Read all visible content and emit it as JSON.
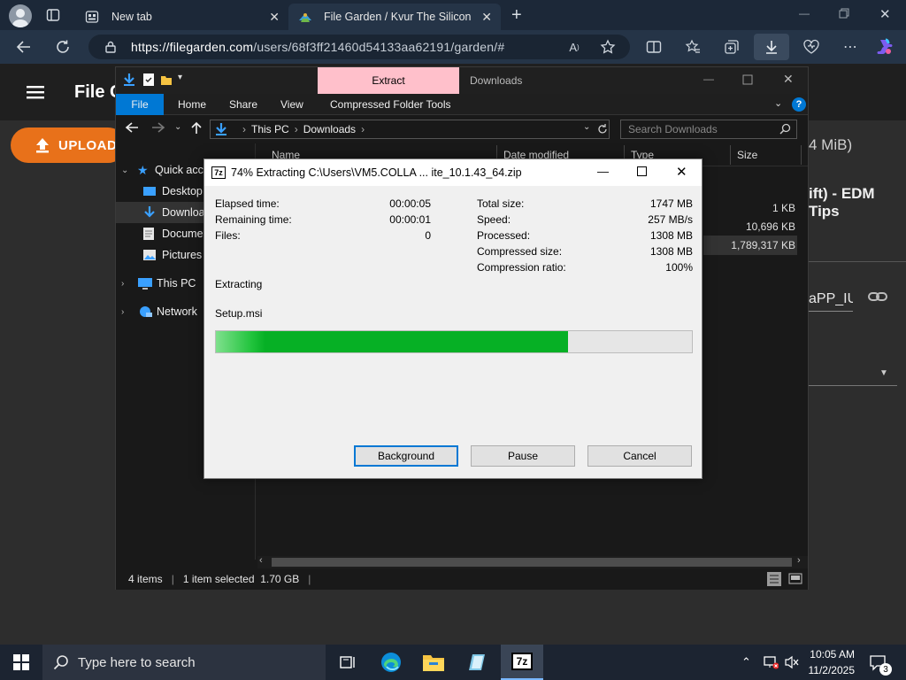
{
  "browser": {
    "tabs": [
      {
        "label": "New tab"
      },
      {
        "label": "File Garden / Kvur The Silicon"
      }
    ],
    "url_host": "https://filegarden.com",
    "url_path": "/users/68f3ff21460d54133aa62191/garden/#"
  },
  "site": {
    "title": "File G",
    "upload_label": "UPLOAD",
    "size_fragment": "4 MiB)",
    "file_title_fragment": "ift) - EDM Tips",
    "file_name_fragment": "aPP_IUY"
  },
  "explorer": {
    "ribbon_tabs": [
      "File",
      "Home",
      "Share",
      "View",
      "Compressed Folder Tools"
    ],
    "extract_tab": "Extract",
    "window_title": "Downloads",
    "breadcrumb": [
      "This PC",
      "Downloads"
    ],
    "search_placeholder": "Search Downloads",
    "columns": {
      "name": "Name",
      "date": "Date modified",
      "type": "Type",
      "size": "Size"
    },
    "nav": {
      "quick_access": "Quick access",
      "desktop": "Desktop",
      "downloads": "Downloads",
      "documents": "Documents",
      "pictures": "Pictures",
      "this_pc": "This PC",
      "network": "Network"
    },
    "file_sizes": [
      "1 KB",
      "10,696 KB",
      "1,789,317 KB"
    ],
    "status": {
      "items": "4 items",
      "selected": "1 item selected  1.70 GB"
    }
  },
  "dialog": {
    "title": "74% Extracting C:\\Users\\VM5.COLLA ... ite_10.1.43_64.zip",
    "app_icon_label": "7z",
    "left_stats": [
      {
        "label": "Elapsed time:",
        "value": "00:00:05"
      },
      {
        "label": "Remaining time:",
        "value": "00:00:01"
      },
      {
        "label": "Files:",
        "value": "0"
      }
    ],
    "right_stats": [
      {
        "label": "Total size:",
        "value": "1747 MB"
      },
      {
        "label": "Speed:",
        "value": "257 MB/s"
      },
      {
        "label": "Processed:",
        "value": "1308 MB"
      },
      {
        "label": "Compressed size:",
        "value": "1308 MB"
      },
      {
        "label": "Compression ratio:",
        "value": "100%"
      }
    ],
    "action": "Extracting",
    "current_file": "Setup.msi",
    "progress": 0.74,
    "progress_color": "#06b025",
    "buttons": {
      "background": "Background",
      "pause": "Pause",
      "cancel": "Cancel"
    }
  },
  "taskbar": {
    "search_placeholder": "Type here to search",
    "time": "10:05 AM",
    "date": "11/2/2025",
    "notification_count": "3",
    "apps": [
      "task-view-icon",
      "edge-icon",
      "file-explorer-icon",
      "notepad-icon",
      "7zip-icon"
    ]
  },
  "colors": {
    "accent": "#0078d4",
    "extract_tab": "#ffc0cb",
    "upload_button": "#e8711a"
  }
}
